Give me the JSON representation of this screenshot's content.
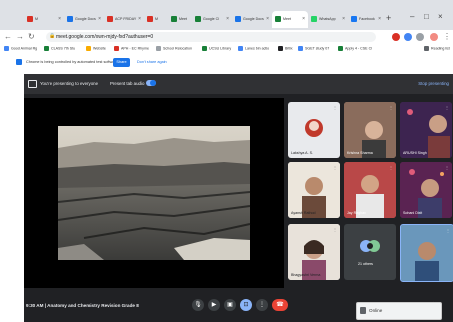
{
  "browser": {
    "tabs": [
      {
        "label": "M",
        "favicon_color": "#d93025"
      },
      {
        "label": "Google Docs",
        "favicon_color": "#1a73e8"
      },
      {
        "label": "ACP FRIDAY",
        "favicon_color": "#d93025"
      },
      {
        "label": "M",
        "favicon_color": "#d93025"
      },
      {
        "label": "Meet",
        "favicon_color": "#188038"
      },
      {
        "label": "Google Cl",
        "favicon_color": "#188038"
      },
      {
        "label": "Google Docs",
        "favicon_color": "#1a73e8"
      },
      {
        "label": "Meet",
        "favicon_color": "#188038",
        "active": true
      },
      {
        "label": "WhatsApp",
        "favicon_color": "#25d366"
      },
      {
        "label": "Facebook",
        "favicon_color": "#1877f2"
      }
    ],
    "url": "meet.google.com/xwn-mjdy-fxd?authuser=0",
    "bookmarks": [
      {
        "label": "Good Animal Rg",
        "color": "#4285f4"
      },
      {
        "label": "CLASS 7th Stu",
        "color": "#188038"
      },
      {
        "label": "Website",
        "color": "#f9ab00"
      },
      {
        "label": "APH - EC Rhyme",
        "color": "#d93025"
      },
      {
        "label": "School Relocation",
        "color": "#9aa0a6"
      },
      {
        "label": "UCSU Library",
        "color": "#188038"
      },
      {
        "label": "Lanes bin actio",
        "color": "#4285f4"
      },
      {
        "label": "Bitlix",
        "color": "#202124"
      },
      {
        "label": "SGET study 07",
        "color": "#4285f4"
      },
      {
        "label": "Apply 4 - CSE Cl",
        "color": "#188038"
      }
    ],
    "reading_list": "Reading list"
  },
  "infobar": {
    "text": "Chrome is being controlled by automated test software.",
    "button": "Share",
    "link": "Don't share again"
  },
  "meet": {
    "presenting_text": "You're presenting to everyone",
    "present_audio_label": "Present tab audio",
    "stop_presenting": "Stop presenting",
    "participants": [
      {
        "name": "Lakshya A. S.",
        "bg": "#e8eaed"
      },
      {
        "name": "Krishna Sharma",
        "bg": "#9c7b6a"
      },
      {
        "name": "ARUSHI Singh",
        "bg": "#4a2a5a"
      },
      {
        "name": "Ayansh Rathod",
        "bg": "#e9e4dc"
      },
      {
        "name": "Jay Raghav",
        "bg": "#c94d4d"
      },
      {
        "name": "Sohani Dixit",
        "bg": "#6a2b60"
      },
      {
        "name": "Bhagyashri Verma",
        "bg": "#e6e1dc"
      },
      {
        "name": "21 others",
        "bg": "#3c4043"
      },
      {
        "name": "",
        "bg": "#6e9bbf"
      }
    ],
    "time": "9:30 AM",
    "separator": "|",
    "meeting_title": "Anatomy and Chemistry Revision Grade 8",
    "download_label": "Online"
  },
  "colors": {
    "meet_bg": "#202124",
    "end_call": "#ea4335",
    "accent": "#1a73e8"
  }
}
